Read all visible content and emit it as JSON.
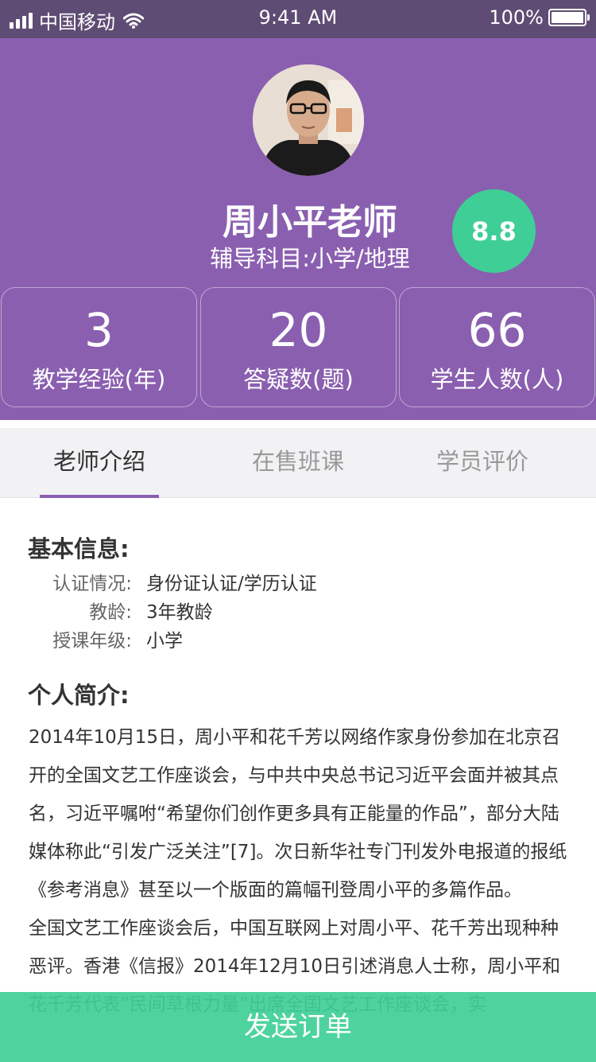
{
  "status_bar": {
    "carrier": "中国移动",
    "time": "9:41 AM",
    "battery": "100%"
  },
  "teacher": {
    "name": "周小平老师",
    "subject": "辅导科目:小学/地理",
    "score": "8.8"
  },
  "stats": [
    {
      "value": "3",
      "label": "教学经验(年)"
    },
    {
      "value": "20",
      "label": "答疑数(题)"
    },
    {
      "value": "66",
      "label": "学生人数(人)"
    }
  ],
  "tabs": [
    {
      "label": "老师介绍",
      "active": true
    },
    {
      "label": "在售班课",
      "active": false
    },
    {
      "label": "学员评价",
      "active": false
    }
  ],
  "basic_info": {
    "title": "基本信息:",
    "rows": [
      {
        "key": "认证情况:",
        "value": "身份证认证/学历认证"
      },
      {
        "key": "教龄:",
        "value": "3年教龄"
      },
      {
        "key": "授课年级:",
        "value": "小学"
      }
    ]
  },
  "intro": {
    "title": "个人简介:",
    "paragraphs": [
      "2014年10月15日，周小平和花千芳以网络作家身份参加在北京召开的全国文艺工作座谈会，与中共中央总书记习近平会面并被其点名，习近平嘱咐“希望你们创作更多具有正能量的作品”，部分大陆媒体称此“引发广泛关注”[7]。次日新华社专门刊发外电报道的报纸《参考消息》甚至以一个版面的篇幅刊登周小平的多篇作品。",
      "全国文艺工作座谈会后，中国互联网上对周小平、花千芳出现种种恶评。香港《信报》2014年12月10日引述消息人士称，周小平和花千芳代表“民间草根力量”出席全国文艺工作座谈会，实"
    ]
  },
  "bottom_button": "发送订单",
  "colors": {
    "header_bg": "#8a5fb0",
    "status_bg": "#5f4c74",
    "accent_green": "#3fcf96"
  }
}
